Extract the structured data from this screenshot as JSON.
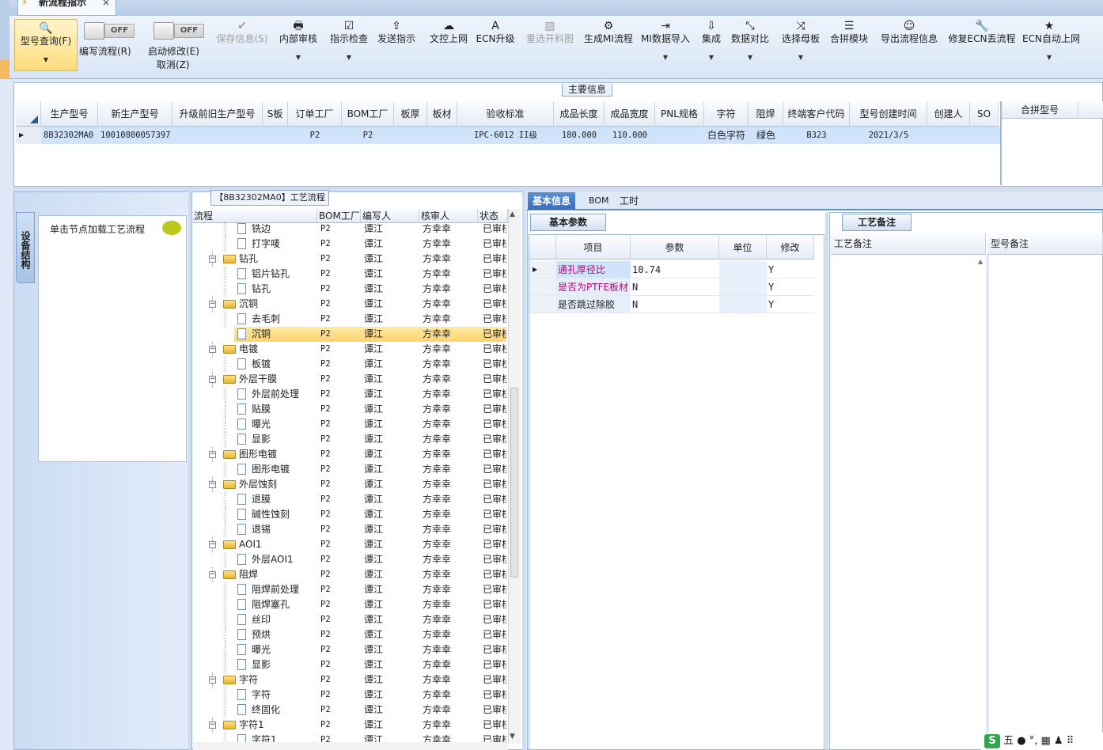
{
  "doc_tab": {
    "label": "新流程指示",
    "close": "×"
  },
  "ribbon": {
    "query": {
      "label": "型号查询(F)"
    },
    "edit_flow": {
      "toggle": "OFF",
      "label": "编写流程(R)"
    },
    "start_modify": {
      "toggle": "OFF",
      "label": "启动修改(E)",
      "cancel": "取消(Z)"
    },
    "buttons": [
      {
        "label": "保存信息(S)",
        "icon": "check-icon",
        "glyph": "✔",
        "disabled": true
      },
      {
        "label": "内部审核",
        "icon": "printer-icon",
        "glyph": "🖶",
        "dropdown": true
      },
      {
        "label": "指示检查",
        "icon": "checkbox-icon",
        "glyph": "☑",
        "dropdown": true
      },
      {
        "label": "发送指示",
        "icon": "upload-icon",
        "glyph": "⇪"
      },
      {
        "label": "文控上网",
        "icon": "cloud-upload-icon",
        "glyph": "☁"
      },
      {
        "label": "ECN升级",
        "icon": "ecn-icon",
        "glyph": "A"
      },
      {
        "label": "重选开料图",
        "icon": "image-icon",
        "glyph": "▧",
        "disabled": true
      },
      {
        "label": "生成MI流程",
        "icon": "gears-icon",
        "glyph": "⚙"
      },
      {
        "label": "MI数据导入",
        "icon": "import-icon",
        "glyph": "⇥",
        "dropdown": true
      },
      {
        "label": "集成",
        "icon": "download-icon",
        "glyph": "⇩",
        "dropdown": true
      },
      {
        "label": "数据对比",
        "icon": "compare-icon",
        "glyph": "⤡",
        "dropdown": true
      },
      {
        "label": "选择母板",
        "icon": "shuffle-icon",
        "glyph": "⤨",
        "dropdown": true
      },
      {
        "label": "合拼模块",
        "icon": "list-icon",
        "glyph": "☰"
      },
      {
        "label": "导出流程信息",
        "icon": "smile-icon",
        "glyph": "☺"
      },
      {
        "label": "修复ECN丢流程",
        "icon": "wrench-icon",
        "glyph": "🔧"
      },
      {
        "label": "ECN自动上网",
        "icon": "star-icon",
        "glyph": "★",
        "dropdown": true
      }
    ]
  },
  "main_info": {
    "title": "主要信息",
    "columns": [
      "生产型号",
      "新生产型号",
      "升级前旧生产型号",
      "S板",
      "订单工厂",
      "BOM工厂",
      "板厚",
      "板材",
      "验收标准",
      "成品长度",
      "成品宽度",
      "PNL规格",
      "字符",
      "阻焊",
      "终端客户代码",
      "型号创建时间",
      "创建人",
      "SO"
    ],
    "row": [
      "8B32302MA0",
      "10010800057397",
      "",
      "",
      "P2",
      "P2",
      "",
      "",
      "IPC-6012 II级",
      "180.000",
      "110.000",
      "",
      "白色字符",
      "绿色",
      "B323",
      "2021/3/5",
      "",
      ""
    ],
    "side_header": "合拼型号"
  },
  "left_pane": {
    "vtab": "设备结构",
    "load_text": "单击节点加载工艺流程"
  },
  "flow_tree": {
    "title": "【8B32302MA0】工艺流程",
    "columns": [
      "流程",
      "BOM工厂",
      "编写人",
      "核审人",
      "状态"
    ],
    "rows": [
      {
        "name": "铣边",
        "level": 2,
        "bom": "P2",
        "writer": "谭江",
        "reviewer": "方幸幸",
        "status": "已审核"
      },
      {
        "name": "打字唛",
        "level": 2,
        "bom": "P2",
        "writer": "谭江",
        "reviewer": "方幸幸",
        "status": "已审核"
      },
      {
        "name": "钻孔",
        "level": 1,
        "bom": "P2",
        "writer": "谭江",
        "reviewer": "方幸幸",
        "status": "已审核"
      },
      {
        "name": "铝片钻孔",
        "level": 2,
        "bom": "P2",
        "writer": "谭江",
        "reviewer": "方幸幸",
        "status": "已审核"
      },
      {
        "name": "钻孔",
        "level": 2,
        "bom": "P2",
        "writer": "谭江",
        "reviewer": "方幸幸",
        "status": "已审核"
      },
      {
        "name": "沉铜",
        "level": 1,
        "bom": "P2",
        "writer": "谭江",
        "reviewer": "方幸幸",
        "status": "已审核"
      },
      {
        "name": "去毛刺",
        "level": 2,
        "bom": "P2",
        "writer": "谭江",
        "reviewer": "方幸幸",
        "status": "已审核"
      },
      {
        "name": "沉铜",
        "level": 2,
        "bom": "P2",
        "writer": "谭江",
        "reviewer": "方幸幸",
        "status": "已审核",
        "selected": true
      },
      {
        "name": "电镀",
        "level": 1,
        "bom": "P2",
        "writer": "谭江",
        "reviewer": "方幸幸",
        "status": "已审核"
      },
      {
        "name": "板镀",
        "level": 2,
        "bom": "P2",
        "writer": "谭江",
        "reviewer": "方幸幸",
        "status": "已审核"
      },
      {
        "name": "外层干膜",
        "level": 1,
        "bom": "P2",
        "writer": "谭江",
        "reviewer": "方幸幸",
        "status": "已审核"
      },
      {
        "name": "外层前处理",
        "level": 2,
        "bom": "P2",
        "writer": "谭江",
        "reviewer": "方幸幸",
        "status": "已审核"
      },
      {
        "name": "贴膜",
        "level": 2,
        "bom": "P2",
        "writer": "谭江",
        "reviewer": "方幸幸",
        "status": "已审核"
      },
      {
        "name": "曝光",
        "level": 2,
        "bom": "P2",
        "writer": "谭江",
        "reviewer": "方幸幸",
        "status": "已审核"
      },
      {
        "name": "显影",
        "level": 2,
        "bom": "P2",
        "writer": "谭江",
        "reviewer": "方幸幸",
        "status": "已审核"
      },
      {
        "name": "图形电镀",
        "level": 1,
        "bom": "P2",
        "writer": "谭江",
        "reviewer": "方幸幸",
        "status": "已审核"
      },
      {
        "name": "图形电镀",
        "level": 2,
        "bom": "P2",
        "writer": "谭江",
        "reviewer": "方幸幸",
        "status": "已审核"
      },
      {
        "name": "外层蚀刻",
        "level": 1,
        "bom": "P2",
        "writer": "谭江",
        "reviewer": "方幸幸",
        "status": "已审核"
      },
      {
        "name": "退膜",
        "level": 2,
        "bom": "P2",
        "writer": "谭江",
        "reviewer": "方幸幸",
        "status": "已审核"
      },
      {
        "name": "碱性蚀刻",
        "level": 2,
        "bom": "P2",
        "writer": "谭江",
        "reviewer": "方幸幸",
        "status": "已审核"
      },
      {
        "name": "退锡",
        "level": 2,
        "bom": "P2",
        "writer": "谭江",
        "reviewer": "方幸幸",
        "status": "已审核"
      },
      {
        "name": "AOI1",
        "level": 1,
        "bom": "P2",
        "writer": "谭江",
        "reviewer": "方幸幸",
        "status": "已审核"
      },
      {
        "name": "外层AOI1",
        "level": 2,
        "bom": "P2",
        "writer": "谭江",
        "reviewer": "方幸幸",
        "status": "已审核"
      },
      {
        "name": "阻焊",
        "level": 1,
        "bom": "P2",
        "writer": "谭江",
        "reviewer": "方幸幸",
        "status": "已审核"
      },
      {
        "name": "阻焊前处理",
        "level": 2,
        "bom": "P2",
        "writer": "谭江",
        "reviewer": "方幸幸",
        "status": "已审核"
      },
      {
        "name": "阻焊塞孔",
        "level": 2,
        "bom": "P2",
        "writer": "谭江",
        "reviewer": "方幸幸",
        "status": "已审核"
      },
      {
        "name": "丝印",
        "level": 2,
        "bom": "P2",
        "writer": "谭江",
        "reviewer": "方幸幸",
        "status": "已审核"
      },
      {
        "name": "预烘",
        "level": 2,
        "bom": "P2",
        "writer": "谭江",
        "reviewer": "方幸幸",
        "status": "已审核"
      },
      {
        "name": "曝光",
        "level": 2,
        "bom": "P2",
        "writer": "谭江",
        "reviewer": "方幸幸",
        "status": "已审核"
      },
      {
        "name": "显影",
        "level": 2,
        "bom": "P2",
        "writer": "谭江",
        "reviewer": "方幸幸",
        "status": "已审核"
      },
      {
        "name": "字符",
        "level": 1,
        "bom": "P2",
        "writer": "谭江",
        "reviewer": "方幸幸",
        "status": "已审核"
      },
      {
        "name": "字符",
        "level": 2,
        "bom": "P2",
        "writer": "谭江",
        "reviewer": "方幸幸",
        "status": "已审核"
      },
      {
        "name": "终固化",
        "level": 2,
        "bom": "P2",
        "writer": "谭江",
        "reviewer": "方幸幸",
        "status": "已审核"
      },
      {
        "name": "字符1",
        "level": 1,
        "bom": "P2",
        "writer": "谭江",
        "reviewer": "方幸幸",
        "status": "已审核"
      },
      {
        "name": "字符1",
        "level": 2,
        "bom": "P2",
        "writer": "谭江",
        "reviewer": "方幸幸",
        "status": "已审核"
      }
    ]
  },
  "right_tabs": [
    "基本信息",
    "BOM",
    "工时"
  ],
  "basic_params": {
    "title": "基本参数",
    "columns": [
      "项目",
      "参数",
      "单位",
      "修改"
    ],
    "rows": [
      {
        "item": "通孔厚径比",
        "value": "10.74",
        "unit": "",
        "modify": "Y",
        "highlight": true
      },
      {
        "item": "是否为PTFE板材",
        "value": "N",
        "unit": "",
        "modify": "Y",
        "highlight": true
      },
      {
        "item": "是否跳过除胶",
        "value": "N",
        "unit": "",
        "modify": "Y",
        "highlight": false
      }
    ]
  },
  "notes": {
    "title": "工艺备注",
    "columns": [
      "工艺备注",
      "型号备注"
    ]
  },
  "ime": {
    "logo": "S",
    "text": "五 ● °, ▦ ♟ ⠿"
  },
  "colors": {
    "accent": "#3a6ec0",
    "selected_row": "#ffd36b",
    "highlight_text": "#c0007a"
  }
}
